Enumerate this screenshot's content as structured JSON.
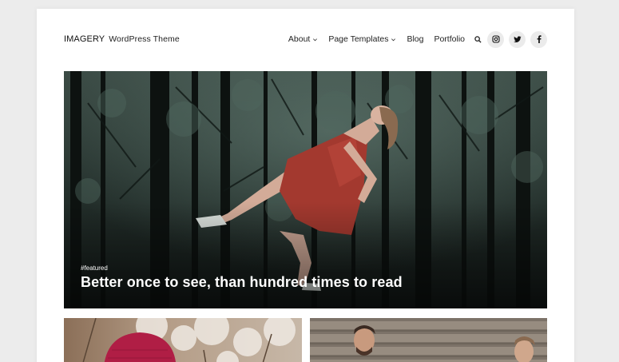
{
  "site": {
    "brand_name": "IMAGERY",
    "brand_tagline": "WordPress Theme"
  },
  "nav": {
    "items": [
      {
        "label": "About",
        "has_dropdown": true
      },
      {
        "label": "Page Templates",
        "has_dropdown": true
      },
      {
        "label": "Blog",
        "has_dropdown": false
      },
      {
        "label": "Portfolio",
        "has_dropdown": false
      }
    ],
    "search_icon": "search-icon",
    "social": [
      "instagram-icon",
      "twitter-icon",
      "facebook-icon"
    ]
  },
  "hero": {
    "tag": "#featured",
    "title": "Better once to see, than hundred times to read",
    "image": "woman-levitating-in-forest-photo"
  },
  "cards": [
    {
      "image": "red-knit-hat-with-cotton-plants-photo"
    },
    {
      "image": "smiling-men-by-wooden-wall-photo"
    }
  ],
  "colors": {
    "background": "#ececec",
    "page": "#ffffff",
    "text": "#222222",
    "social_bg": "#ebebeb"
  }
}
